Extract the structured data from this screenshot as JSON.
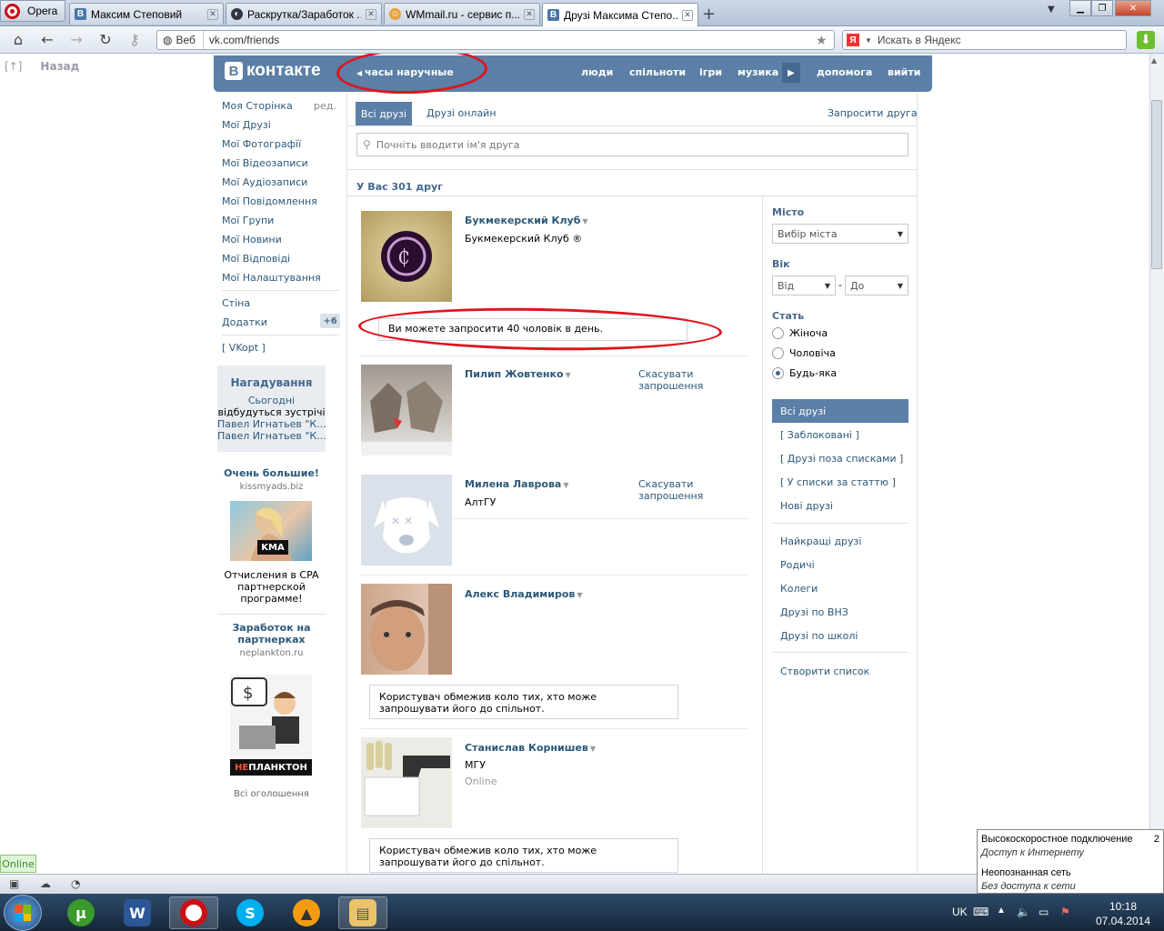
{
  "browser": {
    "menu_label": "Opera",
    "tabs": [
      {
        "title": "Максим Степовий"
      },
      {
        "title": "Раскрутка/Заработок ..."
      },
      {
        "title": "WMmail.ru - сервис п..."
      },
      {
        "title": "Друзі Максима Степо..."
      }
    ],
    "address_mode": "Веб",
    "url": "vk.com/friends",
    "search_placeholder": "Искать в Яндекс",
    "yandex_letter": "Я"
  },
  "page": {
    "back_mark": "[↑]",
    "back_label": "Назад",
    "logo_text": "контакте",
    "logo_letter": "В",
    "status": "часы наручные",
    "menu": [
      "люди",
      "спільноти",
      "ігри",
      "музика",
      "допомога",
      "вийти"
    ],
    "sidebar": {
      "items": [
        "Моя Сторінка",
        "Мої Друзі",
        "Мої Фотографії",
        "Мої Відеозаписи",
        "Мої Аудіозаписи",
        "Мої Повідомлення",
        "Мої Групи",
        "Мої Новини",
        "Мої Відповіді",
        "Мої Налаштування"
      ],
      "edit_label": "ред.",
      "wall": "Стіна",
      "apps": "Додатки",
      "apps_badge": "+6",
      "vkopt": "[ VKopt ]",
      "reminder": {
        "title": "Нагадування",
        "today": "Сьогодні",
        "text": "відбудуться зустрічі",
        "link1": "Павел Игнатьев \"К...,",
        "link2": "Павел Игнатьев \"К..."
      },
      "ads": [
        {
          "title": "Очень большие!",
          "domain": "kissmyads.biz",
          "badge": "KMA",
          "desc": "Отчисления в CPA партнерской программе!"
        },
        {
          "title": "Заработок на партнерках",
          "domain": "neplankton.ru",
          "logo_left": "НЕ",
          "logo_right": "ПЛАНКТОН"
        }
      ],
      "all_ads": "Всі оголошення"
    },
    "tabs": {
      "all": "Всі друзі",
      "online": "Друзі онлайн",
      "invite": "Запросити друга"
    },
    "search_placeholder": "Почніть вводити ім'я друга",
    "count_text": "У Вас 301 друг",
    "invite_limit": "Ви можете запросити 40 чоловік в день.",
    "restricted_note": "Користувач обмежив коло тих, хто може запрошувати його до спільнот.",
    "cancel_request": "Скасувати запрошення",
    "friends": [
      {
        "name": "Букмекерский Клуб",
        "sub": "Букмекерский Клуб ®"
      },
      {
        "name": "Пилип Жовтенко",
        "sub": ""
      },
      {
        "name": "Милена Лаврова",
        "sub": "АлтГУ"
      },
      {
        "name": "Алекс Владимиров",
        "sub": ""
      },
      {
        "name": "Станислав Корнишев",
        "sub": "МГУ",
        "online": "Online"
      }
    ],
    "filter": {
      "city_label": "Місто",
      "city_select": "Вибір міста",
      "age_label": "Вік",
      "age_from": "Від",
      "age_dash": "-",
      "age_to": "До",
      "sex_label": "Стать",
      "sex_options": [
        "Жіноча",
        "Чоловіча",
        "Будь-яка"
      ],
      "sex_selected": "Будь-яка",
      "lists1": [
        "Всі друзі",
        "[ Заблоковані ]",
        "[ Друзі поза списками ]",
        "[ У списки за статтю ]",
        "Нові друзі"
      ],
      "lists2": [
        "Найкращі друзі",
        "Родичі",
        "Колеги",
        "Друзі по ВНЗ",
        "Друзі по школі"
      ],
      "create_list": "Створити список"
    }
  },
  "status_bar": {
    "online": "Online"
  },
  "network_popup": {
    "conn1_name": "Высокоскоростное подключение",
    "conn1_num": "2",
    "conn1_status": "Доступ к Интернету",
    "conn2_name": "Неопознанная сеть",
    "conn2_status": "Без доступа к сети"
  },
  "taskbar": {
    "lang": "UK",
    "time": "10:18",
    "date": "07.04.2014"
  },
  "colors": {
    "vk_blue": "#5b7fa6",
    "link": "#2b587a",
    "annotation": "#e0141e"
  }
}
